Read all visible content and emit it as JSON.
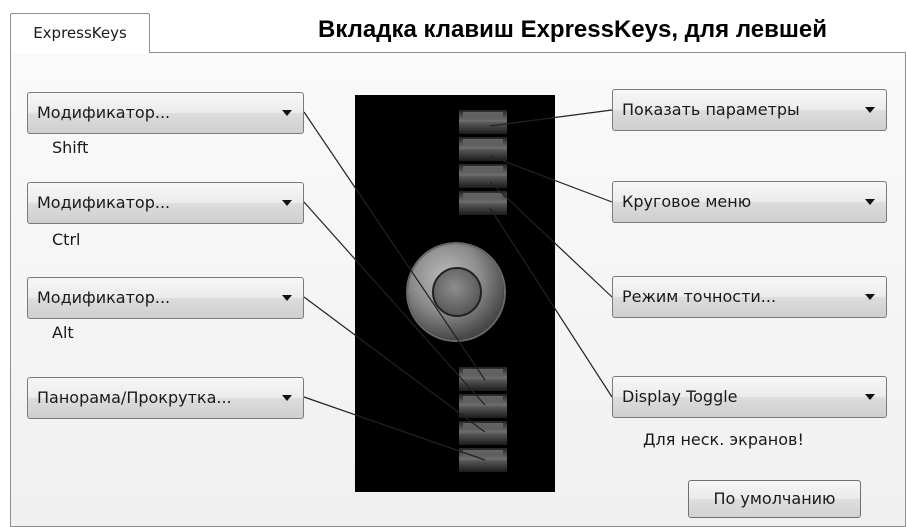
{
  "tab": {
    "label": "ExpressKeys"
  },
  "heading": "Вкладка клавиш ExpressKeys, для левшей",
  "left_dropdowns": [
    {
      "value": "Модификатор...",
      "sublabel": "Shift"
    },
    {
      "value": "Модификатор...",
      "sublabel": "Ctrl"
    },
    {
      "value": "Модификатор...",
      "sublabel": "Alt"
    },
    {
      "value": "Панорама/Прокрутка..."
    }
  ],
  "right_dropdowns": [
    {
      "value": "Показать параметры"
    },
    {
      "value": "Круговое меню"
    },
    {
      "value": "Режим точности..."
    },
    {
      "value": "Display Toggle",
      "sublabel": "Для неск. экранов!"
    }
  ],
  "default_button": {
    "label": "По умолчанию"
  },
  "icons": {
    "dropdown_arrow": "chevron-down-icon"
  }
}
